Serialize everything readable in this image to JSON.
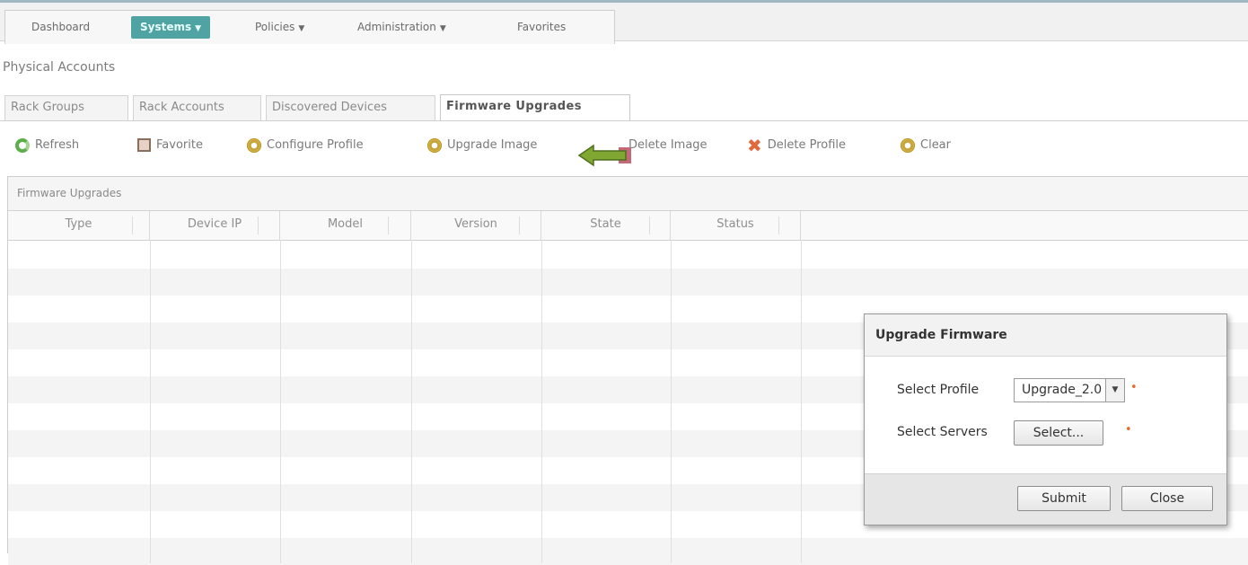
{
  "menu": {
    "items": [
      {
        "label": "Dashboard",
        "has_caret": false,
        "active": false
      },
      {
        "label": "Systems",
        "has_caret": true,
        "active": true
      },
      {
        "label": "Policies",
        "has_caret": true,
        "active": false
      },
      {
        "label": "Administration",
        "has_caret": true,
        "active": false
      },
      {
        "label": "Favorites",
        "has_caret": false,
        "active": false
      }
    ],
    "caret": "▼"
  },
  "page": {
    "title": "Physical Accounts"
  },
  "tabs": [
    {
      "label": "Rack Groups"
    },
    {
      "label": "Rack Accounts"
    },
    {
      "label": "Discovered Devices"
    },
    {
      "label": "Firmware Upgrades",
      "active": true
    }
  ],
  "toolbar": {
    "items": [
      {
        "label": "Refresh",
        "icon": "refresh-icon"
      },
      {
        "label": "Favorite",
        "icon": "favorite-icon"
      },
      {
        "label": "Configure Profile",
        "icon": "gear-icon"
      },
      {
        "label": "Upgrade Image",
        "icon": "gear-icon"
      },
      {
        "label": "Delete Image",
        "icon": "delete-icon"
      },
      {
        "label": "Delete Profile",
        "icon": "x-icon"
      },
      {
        "label": "Clear",
        "icon": "gear-icon"
      }
    ]
  },
  "grid": {
    "title": "Firmware Upgrades",
    "columns": [
      "Type",
      "Device IP",
      "Model",
      "Version",
      "State",
      "Status"
    ]
  },
  "dialog": {
    "title": "Upgrade Firmware",
    "profile_label": "Select Profile",
    "profile_value": "Upgrade_2.0",
    "servers_label": "Select Servers",
    "servers_button": "Select...",
    "submit_label": "Submit",
    "close_label": "Close",
    "required_marker": "•"
  },
  "colors": {
    "accent": "#4fa3a3",
    "required": "#e86b2c",
    "arrow": "#7fa732"
  }
}
